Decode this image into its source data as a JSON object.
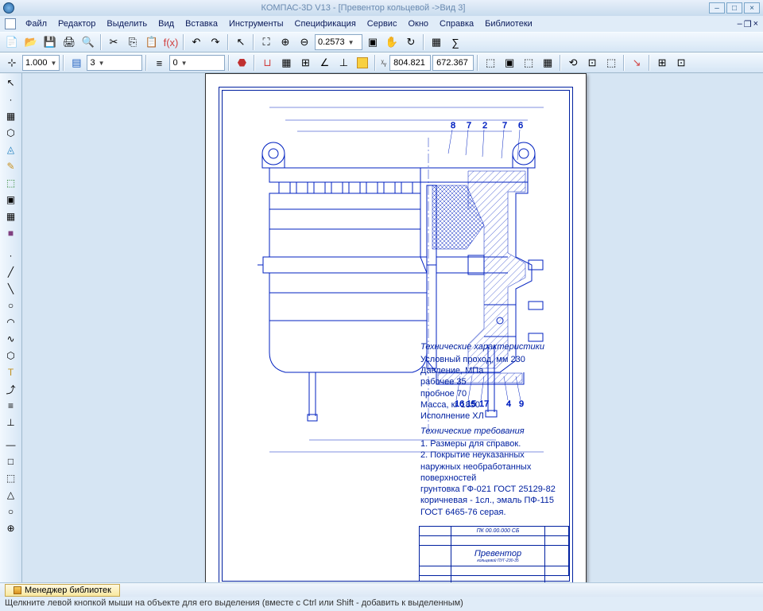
{
  "title": "КОМПАС-3D V13 - [Превентор кольцевой ->Вид 3]",
  "window_buttons": {
    "min": "–",
    "max": "□",
    "close": "×"
  },
  "menu": [
    "Файл",
    "Редактор",
    "Выделить",
    "Вид",
    "Вставка",
    "Инструменты",
    "Спецификация",
    "Сервис",
    "Окно",
    "Справка",
    "Библиотеки"
  ],
  "toolbar1": {
    "zoom_value": "0.2573"
  },
  "toolbar2": {
    "scale": "1.000",
    "layer": "3",
    "style": "0",
    "coord_x": "804.821",
    "coord_y": "672.367"
  },
  "left_tools": [
    "↖",
    "⬚",
    "▦",
    "⬡",
    "◬",
    "✎",
    "⬚",
    "▣",
    "▦",
    "■",
    "·",
    "╱",
    "╲",
    "○",
    "◠",
    "∿",
    "⬡",
    "T",
    "⤴",
    "≡",
    "⊥",
    "—",
    "□",
    "⬚",
    "△",
    "○",
    "⊕"
  ],
  "drawing_labels": {
    "doc_no": "ПК 00.00.000 СБ",
    "title_main": "Превентор",
    "title_sub": "кольцевой ПУГ-230-35"
  },
  "tech_req_heading": "Технические характеристики",
  "tech_req": [
    "Условный проход, мм      230",
    "Давление, МПа",
    "  рабочее                 35",
    "  пробное                 70",
    "Масса, кг               1850",
    "Исполнение               ХЛ"
  ],
  "tech_req2_heading": "Технические требования",
  "tech_req2": [
    "1. Размеры для справок.",
    "2. Покрытие неуказанных наружных необработанных поверхностей",
    "грунтовка ГФ-021 ГОСТ 25129-82 коричневая - 1сл., эмаль ПФ-115",
    "ГОСТ 6465-76 серая."
  ],
  "library_tab": "Менеджер библиотек",
  "hint": "Щелкните левой кнопкой мыши на объекте для его выделения (вместе с Ctrl или Shift - добавить к выделенным)"
}
